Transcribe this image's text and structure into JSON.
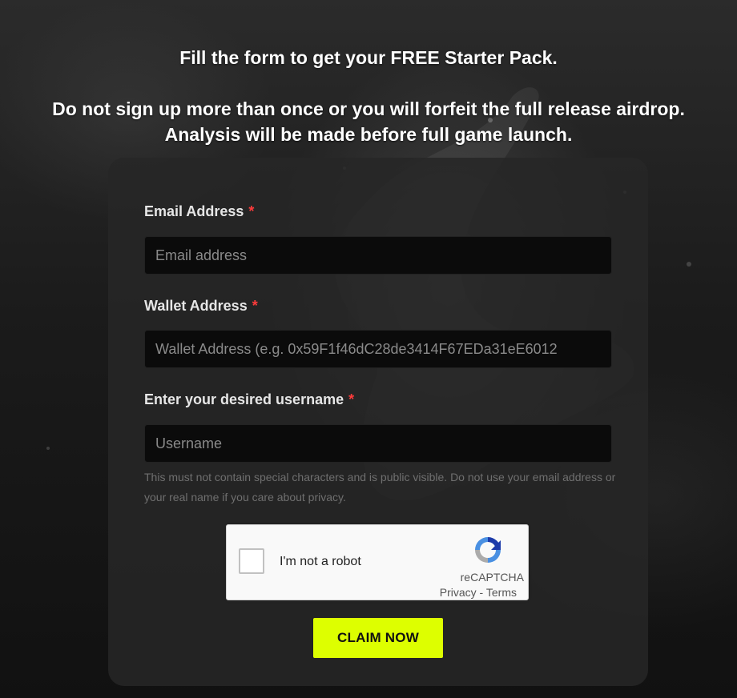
{
  "heading": {
    "line1": "Fill the form to get your FREE Starter Pack.",
    "line2": "Do not sign up more than once or you will forfeit the full release airdrop.",
    "line3": "Analysis will be made before full game launch."
  },
  "form": {
    "email": {
      "label": "Email Address",
      "required_mark": "*",
      "placeholder": "Email address"
    },
    "wallet": {
      "label": "Wallet Address",
      "required_mark": "*",
      "placeholder": "Wallet Address (e.g. 0x59F1f46dC28de3414F67EDa31eE6012"
    },
    "username": {
      "label": "Enter your desired username",
      "required_mark": "*",
      "placeholder": "Username"
    },
    "username_help": "This must not contain special characters and is public visible. Do not use your email address or your real name if you care about privacy."
  },
  "captcha": {
    "label": "I'm not a robot",
    "brand": "reCAPTCHA",
    "privacy": "Privacy",
    "separator": " - ",
    "terms": "Terms",
    "icon": "recaptcha-icon"
  },
  "submit": {
    "label": "CLAIM NOW"
  },
  "colors": {
    "accent": "#ddff00",
    "required": "#ff3b3b",
    "card": "#262626"
  }
}
